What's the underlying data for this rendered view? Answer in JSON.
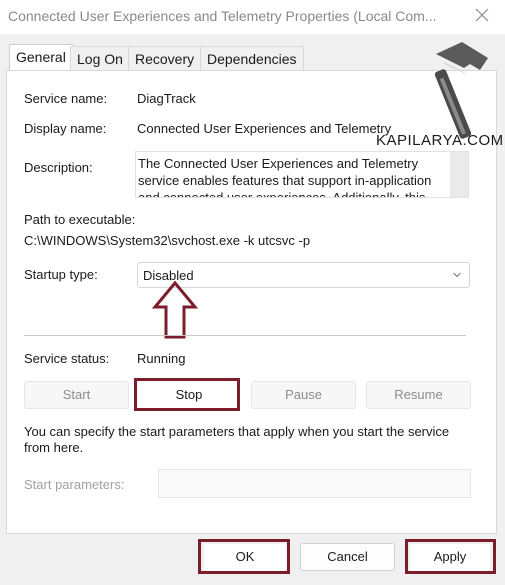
{
  "window": {
    "title": "Connected User Experiences and Telemetry Properties (Local Com..."
  },
  "tabs": [
    {
      "label": "General",
      "active": true
    },
    {
      "label": "Log On",
      "active": false
    },
    {
      "label": "Recovery",
      "active": false
    },
    {
      "label": "Dependencies",
      "active": false
    }
  ],
  "general": {
    "service_name_label": "Service name:",
    "service_name": "DiagTrack",
    "display_name_label": "Display name:",
    "display_name": "Connected User Experiences and Telemetry",
    "description_label": "Description:",
    "description": "The Connected User Experiences and Telemetry service enables features that support in-application and connected user experiences. Additionally, this",
    "path_label": "Path to executable:",
    "path": "C:\\WINDOWS\\System32\\svchost.exe -k utcsvc -p",
    "startup_type_label": "Startup type:",
    "startup_type": "Disabled",
    "service_status_label": "Service status:",
    "service_status": "Running",
    "buttons": {
      "start": "Start",
      "stop": "Stop",
      "pause": "Pause",
      "resume": "Resume"
    },
    "help_text": "You can specify the start parameters that apply when you start the service from here.",
    "start_params_label": "Start parameters:",
    "start_params_value": ""
  },
  "footer": {
    "ok": "OK",
    "cancel": "Cancel",
    "apply": "Apply"
  },
  "watermark": {
    "text": "KAPILARYA.COM",
    "icon": "hammer-icon"
  },
  "colors": {
    "highlight": "#7c1d2b",
    "arrow": "#7c1d2b"
  }
}
